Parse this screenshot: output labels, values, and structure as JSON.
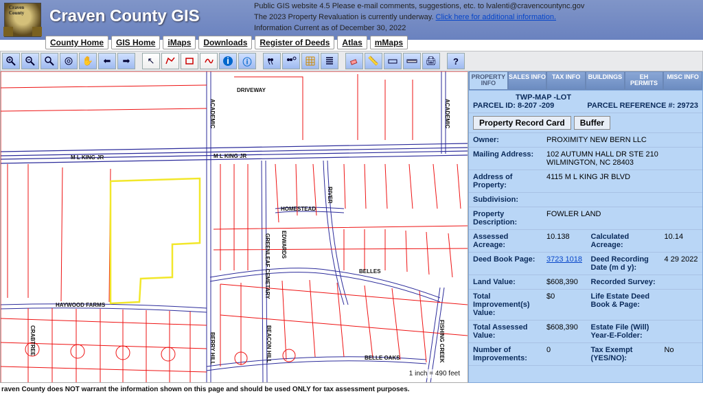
{
  "header": {
    "seal_label": "Craven County",
    "title": "Craven County GIS",
    "notice1": "Public GIS website 4.5 Please e-mail comments, suggestions, etc. to lvalenti@cravencountync.gov",
    "notice2_pre": "The 2023 Property Revaluation is currently underway.  ",
    "notice2_link": "Click here for additional information.",
    "notice3": "Information Current as of December 30, 2022",
    "nav": [
      "County Home",
      "GIS Home",
      "iMaps",
      "Downloads",
      "Register of Deeds",
      "Atlas",
      "mMaps"
    ]
  },
  "toolbar_icons": [
    "zoom-in",
    "zoom-out",
    "magnify",
    "zoom-extent",
    "zoom-window",
    "prev-extent",
    "next-extent",
    "pointer",
    "select-poly",
    "select-rect",
    "select-freehand",
    "identify",
    "info",
    "find",
    "find-adv",
    "grid",
    "layers",
    "eraser",
    "measure-line",
    "measure-area",
    "ruler",
    "print",
    "help"
  ],
  "map": {
    "scale": "1 inch = 490 feet",
    "streets": {
      "mlkjr_w": "M L KING JR",
      "mlkjr_e": "M L KING JR",
      "academic": "ACADEMIC",
      "driveway": "DRIVEWAY",
      "academic2": "ACADEMIC",
      "river": "RIVER",
      "homestead": "HOMESTEAD",
      "edwards": "EDWARDS",
      "greenleaf": "GREENLEAF CEMETARY",
      "belles": "BELLES",
      "fishing": "FISHING CREEK",
      "haywood": "HAYWOOD FARMS",
      "crabtree": "CRABTREE",
      "berry": "BERRY HILL",
      "beacon": "BEACON HILL",
      "belleoaks": "BELLE OAKS"
    }
  },
  "panel": {
    "tabs": [
      "PROPERTY INFO",
      "SALES INFO",
      "TAX INFO",
      "BUILDINGS",
      "EH PERMITS",
      "MISC INFO"
    ],
    "idline": "TWP-MAP   -LOT",
    "idvals": "PARCEL ID:  8-207     -209",
    "ref_lbl": "PARCEL REFERENCE #: ",
    "ref_val": "29723",
    "act1": "Property Record Card",
    "act2": "Buffer",
    "rows": {
      "owner_l": "Owner:",
      "owner_v": "PROXIMITY NEW BERN LLC",
      "ma_l": "Mailing Address:",
      "ma_v": "102 AUTUMN HALL DR STE 210\nWILMINGTON, NC 28403",
      "ap_l": "Address of Property:",
      "ap_v": "4115 M L KING JR BLVD",
      "sub_l": "Subdivision:",
      "sub_v": "",
      "pd_l": "Property Description:",
      "pd_v": "FOWLER LAND",
      "aa_l": "Assessed Acreage:",
      "aa_v": "10.138",
      "ca_l": "Calculated Acreage:",
      "ca_v": "10.14",
      "db_l": "Deed Book Page:",
      "db_v": "3723 1018",
      "drd_l": "Deed Recording Date (m d y):",
      "drd_v": "4 29 2022",
      "lv_l": "Land Value:",
      "lv_v": "$608,390",
      "rs_l": "Recorded Survey:",
      "rs_v": "",
      "ti_l": "Total Improvement(s) Value:",
      "ti_v": "$0",
      "led_l": "Life Estate Deed Book & Page:",
      "led_v": "",
      "ta_l": "Total Assessed Value:",
      "ta_v": "$608,390",
      "ef_l": "Estate File (Will) Year-E-Folder:",
      "ef_v": "",
      "ni_l": "Number of Improvements:",
      "ni_v": "0",
      "te_l": "Tax Exempt (YES/NO):",
      "te_v": "No"
    }
  },
  "disclaimer": "raven County does NOT warrant the information shown on this page and should be used ONLY for tax assessment purposes."
}
